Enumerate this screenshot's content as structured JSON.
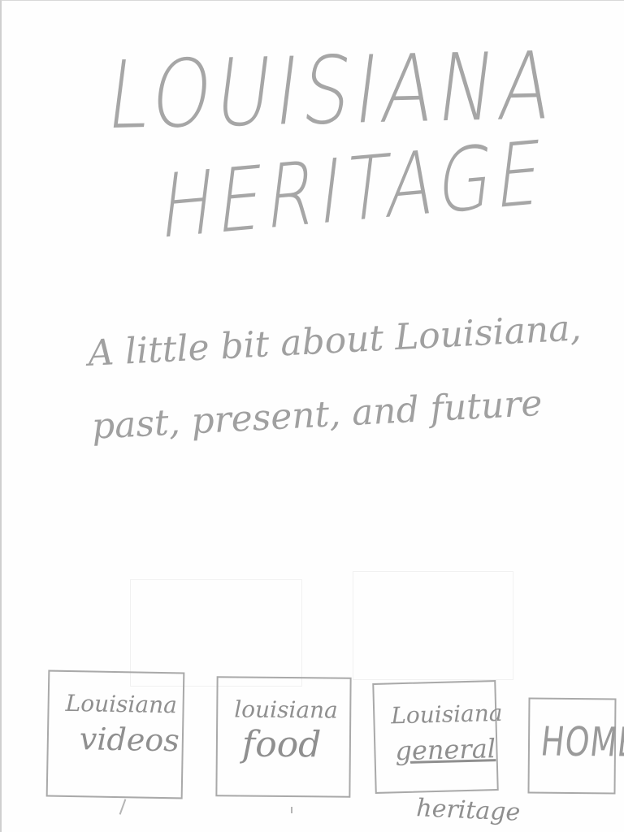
{
  "header": {
    "title_line_1": "LOUISIANA",
    "title_line_2": "HERITAGE"
  },
  "tagline": "A little bit about Louisiana, past, present, and future",
  "nav": {
    "videos": {
      "line1": "Louisiana",
      "line2": "videos"
    },
    "food": {
      "line1": "louisiana",
      "line2": "food"
    },
    "general_heritage": {
      "line1": "Louisiana",
      "line2": "general",
      "line3": "heritage"
    },
    "home": {
      "label": "HOME"
    }
  },
  "colors": {
    "pencil": "#9a9a9a",
    "paper": "#fefefe"
  }
}
